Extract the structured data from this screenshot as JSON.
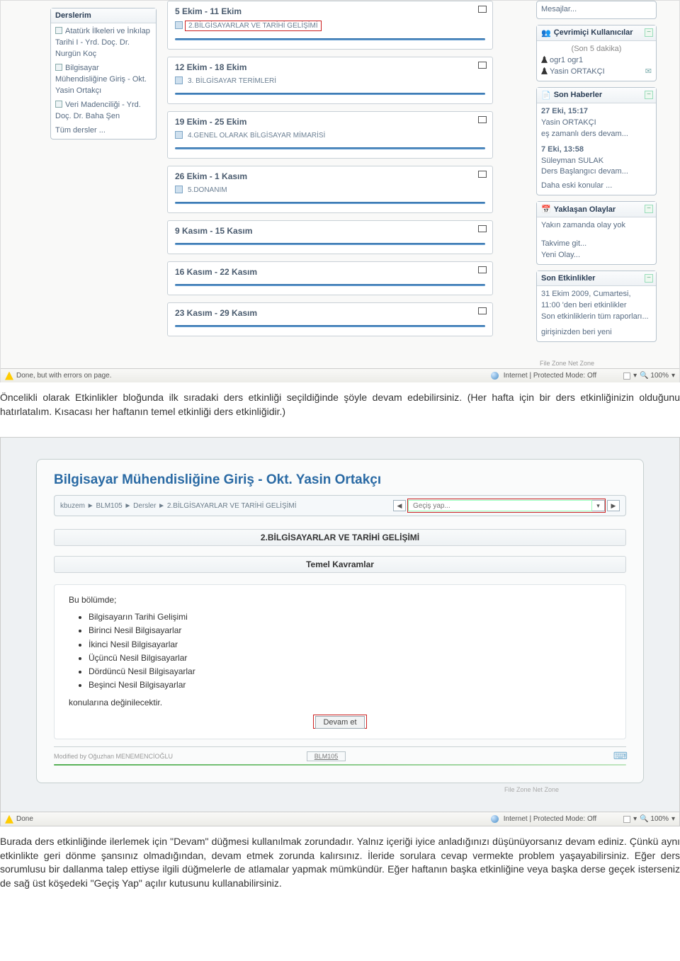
{
  "shot1": {
    "left": {
      "title": "Derslerim",
      "items": [
        "Atatürk İlkeleri ve İnkılap Tarihi I - Yrd. Doç. Dr. Nurgün Koç",
        "Bilgisayar Mühendisliğine Giriş - Okt. Yasin Ortakçı",
        "Veri Madenciliği - Yrd. Doç. Dr. Baha Şen"
      ],
      "all": "Tüm dersler ..."
    },
    "weeks": [
      {
        "title": "5 Ekim - 11 Ekim",
        "resource": "2.BİLGİSAYARLAR VE TARİHİ GELİŞİMİ",
        "highlight": true
      },
      {
        "title": "12 Ekim - 18 Ekim",
        "resource": "3. BİLGİSAYAR TERİMLERİ",
        "highlight": false
      },
      {
        "title": "19 Ekim - 25 Ekim",
        "resource": "4.GENEL OLARAK BİLGİSAYAR MİMARİSİ",
        "highlight": false
      },
      {
        "title": "26 Ekim - 1 Kasım",
        "resource": "5.DONANIM",
        "highlight": false
      },
      {
        "title": "9 Kasım - 15 Kasım",
        "resource": "",
        "highlight": false
      },
      {
        "title": "16 Kasım - 22 Kasım",
        "resource": "",
        "highlight": false
      },
      {
        "title": "23 Kasım - 29 Kasım",
        "resource": "",
        "highlight": false
      }
    ],
    "right": {
      "messages": "Mesajlar...",
      "online_title": "Çevrimiçi Kullanıcılar",
      "last5": "(Son 5 dakika)",
      "users": [
        "ogr1 ogr1",
        "Yasin ORTAKÇI"
      ],
      "news_title": "Son Haberler",
      "news": [
        {
          "meta": "27 Eki, 15:17",
          "who": "Yasin ORTAKÇI",
          "text": "eş zamanlı ders devam..."
        },
        {
          "meta": "7 Eki, 13:58",
          "who": "Süleyman SULAK",
          "text": "Ders Başlangıcı devam..."
        }
      ],
      "older": "Daha eski konular ...",
      "events_title": "Yaklaşan Olaylar",
      "noevents": "Yakın zamanda olay yok",
      "goto_cal": "Takvime git...",
      "new_event": "Yeni Olay...",
      "recent_title": "Son Etkinlikler",
      "recent_time": "31 Ekim 2009, Cumartesi, 11:00 'den beri etkinlikler",
      "recent_link": "Son etkinliklerin tüm raporları...",
      "recent_tail": "girişinizden beri yeni"
    },
    "status": {
      "left": "Done, but with errors on page.",
      "mode": "Internet | Protected Mode: Off",
      "zoom": "100%"
    },
    "filezone": "File Zone   Net Zone"
  },
  "para1": "Öncelikli olarak Etkinlikler bloğunda ilk sıradaki ders etkinliği seçildiğinde şöyle devam edebilirsiniz. (Her hafta için bir ders etkinliğinizin olduğunu hatırlatalım. Kısacası her haftanın temel etkinliği ders etkinliğidir.)",
  "shot2": {
    "heading": "Bilgisayar Mühendisliğine Giriş - Okt. Yasin Ortakçı",
    "crumbs": "kbuzem ► BLM105 ► Dersler ► 2.BİLGİSAYARLAR VE TARİHİ GELİŞİMİ",
    "jump_label": "Geçiş yap...",
    "section_title": "2.BİLGİSAYARLAR VE TARİHİ GELİŞİMİ",
    "subsection": "Temel Kavramlar",
    "intro": "Bu bölümde;",
    "bullets": [
      "Bilgisayarın Tarihi Gelişimi",
      "Birinci Nesil Bilgisayarlar",
      "İkinci Nesil Bilgisayarlar",
      "Üçüncü Nesil Bilgisayarlar",
      "Dördüncü Nesil Bilgisayarlar",
      "Beşinci Nesil Bilgisayarlar"
    ],
    "outro": "konularına değinilecektir.",
    "continue_btn": "Devam et",
    "modified": "Modified by Oğuzhan MENEMENCİOĞLU",
    "blm": "BLM105",
    "status_left": "Done",
    "status_mode": "Internet | Protected Mode: Off",
    "status_zoom": "100%",
    "filezone": "File Zone   Net Zone"
  },
  "para2": "Burada ders etkinliğinde ilerlemek için \"Devam\" düğmesi kullanılmak zorundadır. Yalnız içeriği iyice anladığınızı düşünüyorsanız devam ediniz. Çünkü aynı etkinlikte geri dönme şansınız olmadığından, devam etmek zorunda kalırsınız. İleride sorulara cevap vermekte problem yaşayabilirsiniz. Eğer ders sorumlusu bir dallanma talep ettiyse ilgili düğmelerle de atlamalar yapmak mümkündür. Eğer haftanın başka etkinliğine veya başka derse geçek isterseniz de sağ üst köşedeki \"Geçiş Yap\" açılır kutusunu kullanabilirsiniz."
}
